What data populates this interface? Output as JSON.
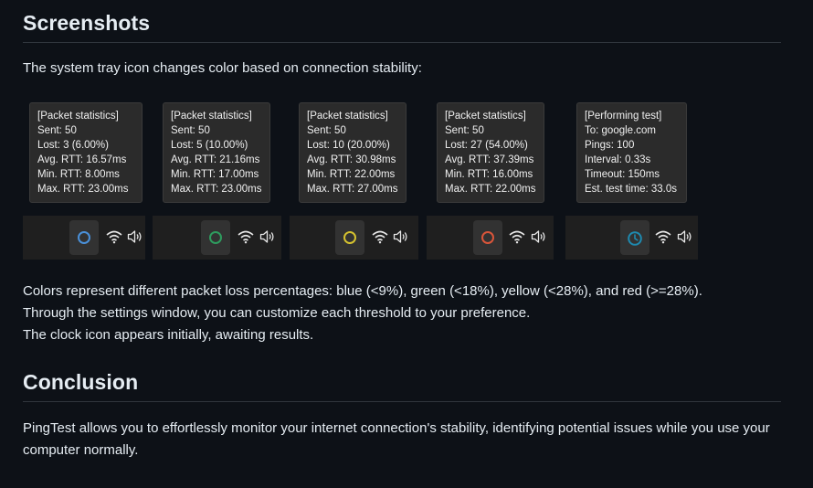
{
  "screenshots_heading": "Screenshots",
  "intro_text": "The system tray icon changes color based on connection stability:",
  "screenshots": [
    {
      "lines": [
        "[Packet statistics]",
        "Sent: 50",
        "Lost: 3 (6.00%)",
        "Avg. RTT: 16.57ms",
        "Min. RTT: 8.00ms",
        "Max. RTT: 23.00ms"
      ],
      "icon": "ring-icon",
      "icon_color": "#4a90d9"
    },
    {
      "lines": [
        "[Packet statistics]",
        "Sent: 50",
        "Lost: 5 (10.00%)",
        "Avg. RTT: 21.16ms",
        "Min. RTT: 17.00ms",
        "Max. RTT: 23.00ms"
      ],
      "icon": "ring-icon",
      "icon_color": "#2e9b5e"
    },
    {
      "lines": [
        "[Packet statistics]",
        "Sent: 50",
        "Lost: 10 (20.00%)",
        "Avg. RTT: 30.98ms",
        "Min. RTT: 22.00ms",
        "Max. RTT: 27.00ms"
      ],
      "icon": "ring-icon",
      "icon_color": "#d4c12f"
    },
    {
      "lines": [
        "[Packet statistics]",
        "Sent: 50",
        "Lost: 27 (54.00%)",
        "Avg. RTT: 37.39ms",
        "Min. RTT: 16.00ms",
        "Max. RTT: 22.00ms"
      ],
      "icon": "ring-icon",
      "icon_color": "#d9553a"
    },
    {
      "lines": [
        "[Performing test]",
        "To: google.com",
        "Pings: 100",
        "Interval: 0.33s",
        "Timeout: 150ms",
        "Est. test time: 33.0s"
      ],
      "icon": "clock-icon",
      "icon_color": "#1e8ab0"
    }
  ],
  "colors_text": "Colors represent different packet loss percentages: blue (<9%), green (<18%), yellow (<28%), and red (>=28%).",
  "settings_text": "Through the settings window, you can customize each threshold to your preference.",
  "clock_text": "The clock icon appears initially, awaiting results.",
  "conclusion_heading": "Conclusion",
  "conclusion_text": "PingTest allows you to effortlessly monitor your internet connection's stability, identifying potential issues while you use your computer normally."
}
